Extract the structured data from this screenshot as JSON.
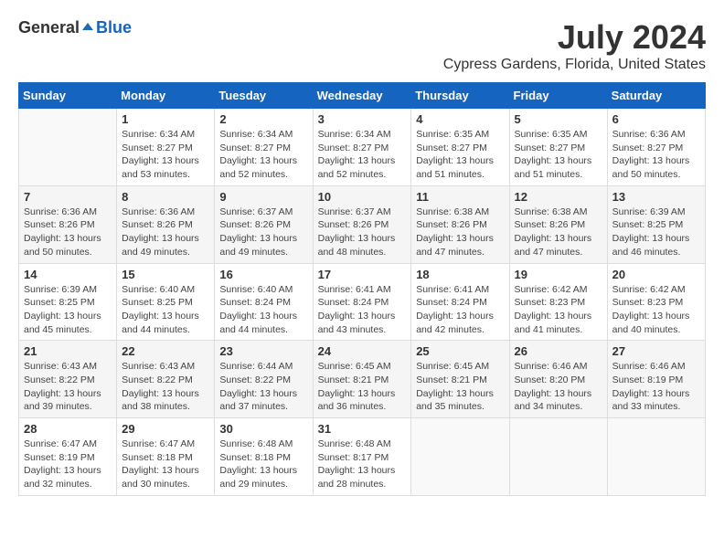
{
  "header": {
    "logo_general": "General",
    "logo_blue": "Blue",
    "month": "July 2024",
    "location": "Cypress Gardens, Florida, United States"
  },
  "weekdays": [
    "Sunday",
    "Monday",
    "Tuesday",
    "Wednesday",
    "Thursday",
    "Friday",
    "Saturday"
  ],
  "weeks": [
    [
      {
        "day": "",
        "sunrise": "",
        "sunset": "",
        "daylight": ""
      },
      {
        "day": "1",
        "sunrise": "Sunrise: 6:34 AM",
        "sunset": "Sunset: 8:27 PM",
        "daylight": "Daylight: 13 hours and 53 minutes."
      },
      {
        "day": "2",
        "sunrise": "Sunrise: 6:34 AM",
        "sunset": "Sunset: 8:27 PM",
        "daylight": "Daylight: 13 hours and 52 minutes."
      },
      {
        "day": "3",
        "sunrise": "Sunrise: 6:34 AM",
        "sunset": "Sunset: 8:27 PM",
        "daylight": "Daylight: 13 hours and 52 minutes."
      },
      {
        "day": "4",
        "sunrise": "Sunrise: 6:35 AM",
        "sunset": "Sunset: 8:27 PM",
        "daylight": "Daylight: 13 hours and 51 minutes."
      },
      {
        "day": "5",
        "sunrise": "Sunrise: 6:35 AM",
        "sunset": "Sunset: 8:27 PM",
        "daylight": "Daylight: 13 hours and 51 minutes."
      },
      {
        "day": "6",
        "sunrise": "Sunrise: 6:36 AM",
        "sunset": "Sunset: 8:27 PM",
        "daylight": "Daylight: 13 hours and 50 minutes."
      }
    ],
    [
      {
        "day": "7",
        "sunrise": "Sunrise: 6:36 AM",
        "sunset": "Sunset: 8:26 PM",
        "daylight": "Daylight: 13 hours and 50 minutes."
      },
      {
        "day": "8",
        "sunrise": "Sunrise: 6:36 AM",
        "sunset": "Sunset: 8:26 PM",
        "daylight": "Daylight: 13 hours and 49 minutes."
      },
      {
        "day": "9",
        "sunrise": "Sunrise: 6:37 AM",
        "sunset": "Sunset: 8:26 PM",
        "daylight": "Daylight: 13 hours and 49 minutes."
      },
      {
        "day": "10",
        "sunrise": "Sunrise: 6:37 AM",
        "sunset": "Sunset: 8:26 PM",
        "daylight": "Daylight: 13 hours and 48 minutes."
      },
      {
        "day": "11",
        "sunrise": "Sunrise: 6:38 AM",
        "sunset": "Sunset: 8:26 PM",
        "daylight": "Daylight: 13 hours and 47 minutes."
      },
      {
        "day": "12",
        "sunrise": "Sunrise: 6:38 AM",
        "sunset": "Sunset: 8:26 PM",
        "daylight": "Daylight: 13 hours and 47 minutes."
      },
      {
        "day": "13",
        "sunrise": "Sunrise: 6:39 AM",
        "sunset": "Sunset: 8:25 PM",
        "daylight": "Daylight: 13 hours and 46 minutes."
      }
    ],
    [
      {
        "day": "14",
        "sunrise": "Sunrise: 6:39 AM",
        "sunset": "Sunset: 8:25 PM",
        "daylight": "Daylight: 13 hours and 45 minutes."
      },
      {
        "day": "15",
        "sunrise": "Sunrise: 6:40 AM",
        "sunset": "Sunset: 8:25 PM",
        "daylight": "Daylight: 13 hours and 44 minutes."
      },
      {
        "day": "16",
        "sunrise": "Sunrise: 6:40 AM",
        "sunset": "Sunset: 8:24 PM",
        "daylight": "Daylight: 13 hours and 44 minutes."
      },
      {
        "day": "17",
        "sunrise": "Sunrise: 6:41 AM",
        "sunset": "Sunset: 8:24 PM",
        "daylight": "Daylight: 13 hours and 43 minutes."
      },
      {
        "day": "18",
        "sunrise": "Sunrise: 6:41 AM",
        "sunset": "Sunset: 8:24 PM",
        "daylight": "Daylight: 13 hours and 42 minutes."
      },
      {
        "day": "19",
        "sunrise": "Sunrise: 6:42 AM",
        "sunset": "Sunset: 8:23 PM",
        "daylight": "Daylight: 13 hours and 41 minutes."
      },
      {
        "day": "20",
        "sunrise": "Sunrise: 6:42 AM",
        "sunset": "Sunset: 8:23 PM",
        "daylight": "Daylight: 13 hours and 40 minutes."
      }
    ],
    [
      {
        "day": "21",
        "sunrise": "Sunrise: 6:43 AM",
        "sunset": "Sunset: 8:22 PM",
        "daylight": "Daylight: 13 hours and 39 minutes."
      },
      {
        "day": "22",
        "sunrise": "Sunrise: 6:43 AM",
        "sunset": "Sunset: 8:22 PM",
        "daylight": "Daylight: 13 hours and 38 minutes."
      },
      {
        "day": "23",
        "sunrise": "Sunrise: 6:44 AM",
        "sunset": "Sunset: 8:22 PM",
        "daylight": "Daylight: 13 hours and 37 minutes."
      },
      {
        "day": "24",
        "sunrise": "Sunrise: 6:45 AM",
        "sunset": "Sunset: 8:21 PM",
        "daylight": "Daylight: 13 hours and 36 minutes."
      },
      {
        "day": "25",
        "sunrise": "Sunrise: 6:45 AM",
        "sunset": "Sunset: 8:21 PM",
        "daylight": "Daylight: 13 hours and 35 minutes."
      },
      {
        "day": "26",
        "sunrise": "Sunrise: 6:46 AM",
        "sunset": "Sunset: 8:20 PM",
        "daylight": "Daylight: 13 hours and 34 minutes."
      },
      {
        "day": "27",
        "sunrise": "Sunrise: 6:46 AM",
        "sunset": "Sunset: 8:19 PM",
        "daylight": "Daylight: 13 hours and 33 minutes."
      }
    ],
    [
      {
        "day": "28",
        "sunrise": "Sunrise: 6:47 AM",
        "sunset": "Sunset: 8:19 PM",
        "daylight": "Daylight: 13 hours and 32 minutes."
      },
      {
        "day": "29",
        "sunrise": "Sunrise: 6:47 AM",
        "sunset": "Sunset: 8:18 PM",
        "daylight": "Daylight: 13 hours and 30 minutes."
      },
      {
        "day": "30",
        "sunrise": "Sunrise: 6:48 AM",
        "sunset": "Sunset: 8:18 PM",
        "daylight": "Daylight: 13 hours and 29 minutes."
      },
      {
        "day": "31",
        "sunrise": "Sunrise: 6:48 AM",
        "sunset": "Sunset: 8:17 PM",
        "daylight": "Daylight: 13 hours and 28 minutes."
      },
      {
        "day": "",
        "sunrise": "",
        "sunset": "",
        "daylight": ""
      },
      {
        "day": "",
        "sunrise": "",
        "sunset": "",
        "daylight": ""
      },
      {
        "day": "",
        "sunrise": "",
        "sunset": "",
        "daylight": ""
      }
    ]
  ]
}
